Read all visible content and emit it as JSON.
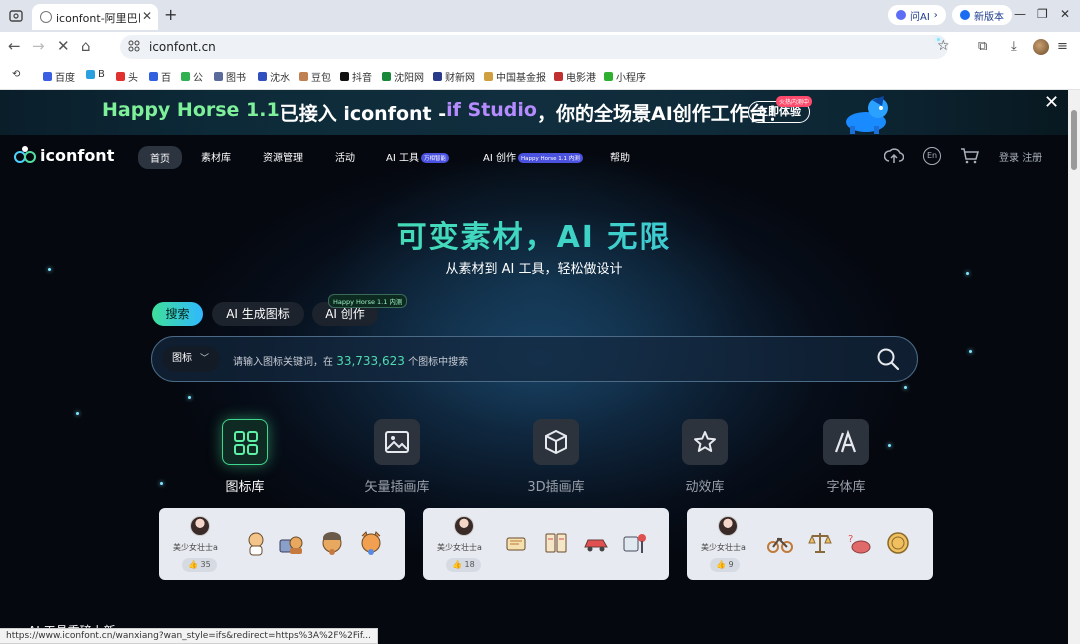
{
  "browser": {
    "tab_title": "iconfont-阿里巴巴矢量图标库",
    "tab_close": "✕",
    "new_tab": "+",
    "pill_ai": "问AI",
    "pill_version": "新版本",
    "url": "iconfont.cn",
    "bookmarks": [
      "百度",
      "B",
      "头",
      "百",
      "公",
      "图书",
      "沈水",
      "豆包",
      "抖音",
      "沈阳网",
      "财新网",
      "中国基金报",
      "电影港",
      "小程序"
    ],
    "status_url": "https://www.iconfont.cn/wanxiang?wan_style=ifs&redirect=https%3A%2F%2Fif..."
  },
  "banner": {
    "part1": "Happy Horse 1.1",
    "part2": " 已接入 iconfont - ",
    "part3": "if Studio",
    "part4": "，你的全场景AI创作工作台！",
    "cta": "立即体验",
    "cta_badge": "火热内测中",
    "close": "✕"
  },
  "nav": {
    "logo": "iconfont",
    "items": [
      "首页",
      "素材库",
      "资源管理",
      "活动",
      "AI 工具",
      "AI 创作",
      "帮助"
    ],
    "tag_ai_tools": "万相智能",
    "tag_ai_create": "Happy Horse 1.1 内测",
    "lang": "En",
    "login": "登录",
    "register": "注册"
  },
  "hero": {
    "title": "可变素材，AI 无限",
    "subtitle": "从素材到 AI 工具，轻松做设计"
  },
  "search_tabs": {
    "tabs": [
      "搜索",
      "AI 生成图标",
      "AI 创作"
    ],
    "ai_create_tag": "Happy Horse 1.1 内测"
  },
  "search": {
    "type": "图标",
    "placeholder_pre": "请输入图标关键词，在 ",
    "count": "33,733,623",
    "placeholder_post": " 个图标中搜索"
  },
  "categories": [
    "图标库",
    "矢量插画库",
    "3D插画库",
    "动效库",
    "字体库"
  ],
  "cards": [
    {
      "user": "美少女壮士a",
      "likes": "35"
    },
    {
      "user": "美少女壮士a",
      "likes": "18"
    },
    {
      "user": "美少女壮士a",
      "likes": "9"
    }
  ],
  "section_heading": "AI 工具重磅上新",
  "colors": {
    "accent_green": "#3fe09a",
    "accent_blue": "#30b8ff",
    "page_bg": "#05080f"
  }
}
